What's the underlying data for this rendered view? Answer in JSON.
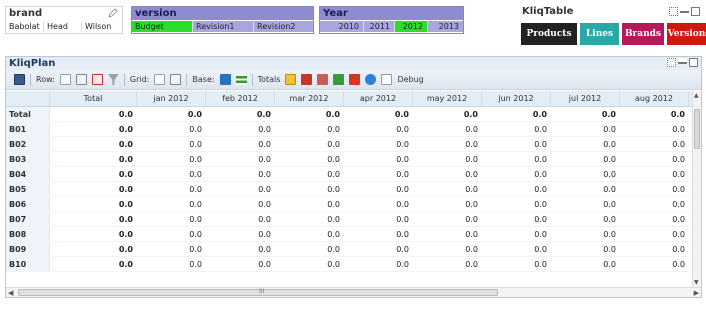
{
  "brand": {
    "title": "brand",
    "values": [
      "Babolat",
      "Head",
      "Wilson"
    ]
  },
  "version": {
    "title": "version",
    "values": [
      "Budget",
      "Revision1",
      "Revision2"
    ],
    "selected": "Budget"
  },
  "year": {
    "title": "Year",
    "values": [
      "2010",
      "2011",
      "2012",
      "2013"
    ],
    "selected": "2012"
  },
  "kliqtable": {
    "title": "KliqTable",
    "tabs": [
      "Products",
      "Lines",
      "Brands",
      "Versions"
    ]
  },
  "kliqplan": {
    "title": "KliqPlan",
    "toolbar": {
      "row_label": "Row:",
      "grid_label": "Grid:",
      "base_label": "Base:",
      "totals_label": "Totals",
      "debug_label": "Debug"
    },
    "columns": [
      "",
      "Total",
      "jan 2012",
      "feb 2012",
      "mar 2012",
      "apr 2012",
      "may 2012",
      "jun 2012",
      "jul 2012",
      "aug 2012"
    ],
    "rows": [
      {
        "label": "Total",
        "values": [
          "0.0",
          "0.0",
          "0.0",
          "0.0",
          "0.0",
          "0.0",
          "0.0",
          "0.0",
          "0.0"
        ]
      },
      {
        "label": "B01",
        "values": [
          "0.0",
          "0.0",
          "0.0",
          "0.0",
          "0.0",
          "0.0",
          "0.0",
          "0.0",
          "0.0"
        ]
      },
      {
        "label": "B02",
        "values": [
          "0.0",
          "0.0",
          "0.0",
          "0.0",
          "0.0",
          "0.0",
          "0.0",
          "0.0",
          "0.0"
        ]
      },
      {
        "label": "B03",
        "values": [
          "0.0",
          "0.0",
          "0.0",
          "0.0",
          "0.0",
          "0.0",
          "0.0",
          "0.0",
          "0.0"
        ]
      },
      {
        "label": "B04",
        "values": [
          "0.0",
          "0.0",
          "0.0",
          "0.0",
          "0.0",
          "0.0",
          "0.0",
          "0.0",
          "0.0"
        ]
      },
      {
        "label": "B05",
        "values": [
          "0.0",
          "0.0",
          "0.0",
          "0.0",
          "0.0",
          "0.0",
          "0.0",
          "0.0",
          "0.0"
        ]
      },
      {
        "label": "B06",
        "values": [
          "0.0",
          "0.0",
          "0.0",
          "0.0",
          "0.0",
          "0.0",
          "0.0",
          "0.0",
          "0.0"
        ]
      },
      {
        "label": "B07",
        "values": [
          "0.0",
          "0.0",
          "0.0",
          "0.0",
          "0.0",
          "0.0",
          "0.0",
          "0.0",
          "0.0"
        ]
      },
      {
        "label": "B08",
        "values": [
          "0.0",
          "0.0",
          "0.0",
          "0.0",
          "0.0",
          "0.0",
          "0.0",
          "0.0",
          "0.0"
        ]
      },
      {
        "label": "B09",
        "values": [
          "0.0",
          "0.0",
          "0.0",
          "0.0",
          "0.0",
          "0.0",
          "0.0",
          "0.0",
          "0.0"
        ]
      },
      {
        "label": "B10",
        "values": [
          "0.0",
          "0.0",
          "0.0",
          "0.0",
          "0.0",
          "0.0",
          "0.0",
          "0.0",
          "0.0"
        ]
      }
    ],
    "scroll_label": "III"
  },
  "colors": {
    "selected": "#2bdc2b",
    "version_header": "#8f8bd0",
    "products": "#222222",
    "lines": "#2aa8a6",
    "brands": "#b6185a",
    "versions": "#d0180f"
  }
}
